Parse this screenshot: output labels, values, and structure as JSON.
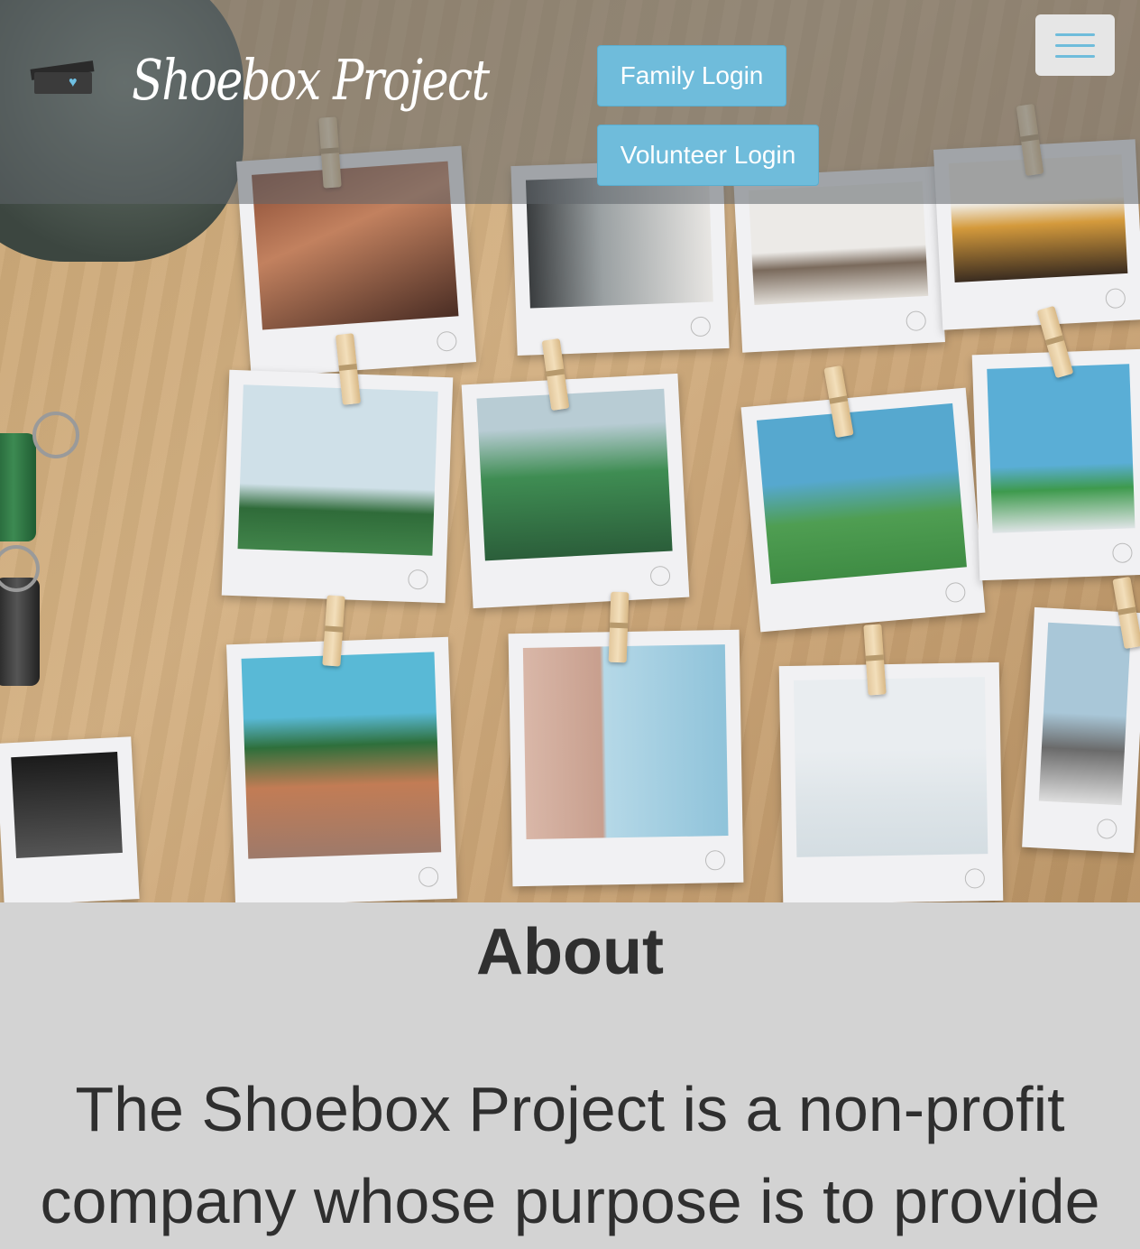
{
  "header": {
    "logo_text": "Shoebox Project",
    "family_login": "Family Login",
    "volunteer_login": "Volunteer Login",
    "menu_icon": "hamburger-icon"
  },
  "hero": {
    "image": "polaroid-photos-on-table"
  },
  "about": {
    "title": "About",
    "text": "The Shoebox Project is a non-profit company whose purpose is to provide"
  },
  "colors": {
    "accent": "#6fbcdb",
    "header_overlay": "#5f6469",
    "about_bg": "#d3d3d3",
    "text": "#2f2f2f"
  }
}
